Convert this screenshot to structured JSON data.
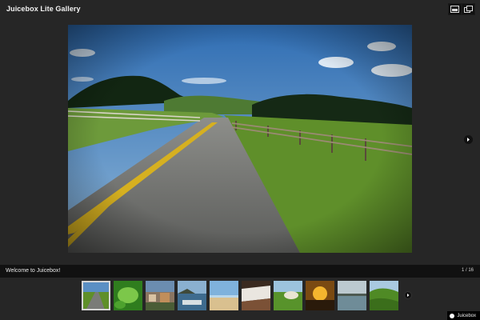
{
  "gallery": {
    "title": "Juicebox Lite Gallery",
    "caption": "Welcome to Juicebox!",
    "counter": "1 / 16",
    "brand": "Juicebox"
  },
  "icons": {
    "expand": "expand-icon",
    "thumbnails": "thumbnails-icon",
    "next": "chevron-right-icon",
    "brand": "juicebox-logo-icon"
  },
  "colors": {
    "background": "#262626",
    "bar": "#111111",
    "text": "#f2f2f2",
    "thumb_selected_border": "#d6d6d6"
  },
  "thumbnails": [
    {
      "subject": "road",
      "selected": true
    },
    {
      "subject": "green leaves",
      "selected": false
    },
    {
      "subject": "houses",
      "selected": false
    },
    {
      "subject": "coast",
      "selected": false
    },
    {
      "subject": "beach",
      "selected": false
    },
    {
      "subject": "rocks",
      "selected": false
    },
    {
      "subject": "meadow",
      "selected": false
    },
    {
      "subject": "sunset",
      "selected": false
    },
    {
      "subject": "lake",
      "selected": false
    },
    {
      "subject": "hills",
      "selected": false
    }
  ]
}
